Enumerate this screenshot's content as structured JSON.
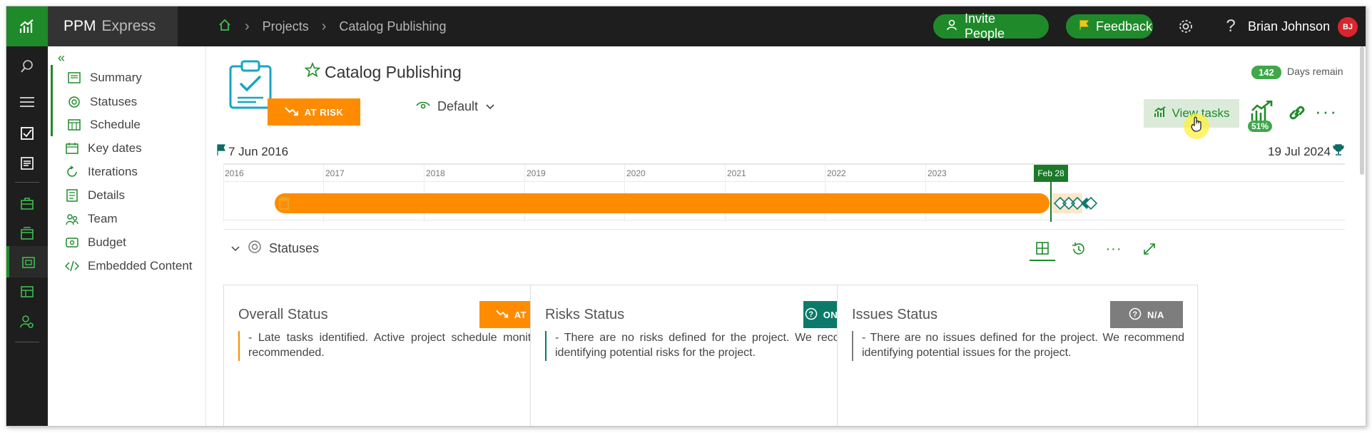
{
  "app": {
    "brand_main": "PPM",
    "brand_sub": "Express"
  },
  "breadcrumb": {
    "items": [
      "Projects",
      "Catalog Publishing"
    ]
  },
  "header": {
    "invite_label": "Invite People",
    "feedback_label": "Feedback",
    "user_name": "Brian Johnson",
    "user_initials": "BJ"
  },
  "sidebar": {
    "items": [
      {
        "label": "Summary",
        "icon": "summary-icon"
      },
      {
        "label": "Statuses",
        "icon": "statuses-icon"
      },
      {
        "label": "Schedule",
        "icon": "schedule-icon"
      },
      {
        "label": "Key dates",
        "icon": "key-dates-icon"
      },
      {
        "label": "Iterations",
        "icon": "iterations-icon"
      },
      {
        "label": "Details",
        "icon": "details-icon"
      },
      {
        "label": "Team",
        "icon": "team-icon"
      },
      {
        "label": "Budget",
        "icon": "budget-icon"
      },
      {
        "label": "Embedded Content",
        "icon": "embed-icon"
      }
    ]
  },
  "project": {
    "title": "Catalog Publishing",
    "status_label": "AT RISK",
    "view_label": "Default",
    "days_remain_count": "142",
    "days_remain_label": "Days remain",
    "view_tasks_label": "View tasks",
    "progress_label": "51%",
    "start_date": "7 Jun 2016",
    "end_date": "19 Jul 2024"
  },
  "timeline": {
    "years": [
      "2016",
      "2017",
      "2018",
      "2019",
      "2020",
      "2021",
      "2022",
      "2023"
    ],
    "today_label": "Feb 28"
  },
  "statuses": {
    "section_title": "Statuses",
    "cards": [
      {
        "title": "Overall Status",
        "badge": "AT RISK",
        "badge_color": "#ff8c00",
        "accent": "#ff8c00",
        "text": "- Late tasks identified. Active project schedule monitoring is recommended."
      },
      {
        "title": "Risks Status",
        "badge": "ON TRACK",
        "badge_color": "#0b7a6a",
        "accent": "#0b7a6a",
        "text": "- There are no risks defined for the project. We recommend identifying potential risks for the project."
      },
      {
        "title": "Issues Status",
        "badge": "N/A",
        "badge_color": "#7d7d7d",
        "accent": "#7d7d7d",
        "text": "- There are no issues defined for the project. We recommend identifying potential issues for the project."
      }
    ]
  },
  "colors": {
    "brand_green": "#1f8a2a",
    "at_risk": "#ff8c00",
    "topbar": "#1e1e1e",
    "teal": "#16a5c4"
  }
}
